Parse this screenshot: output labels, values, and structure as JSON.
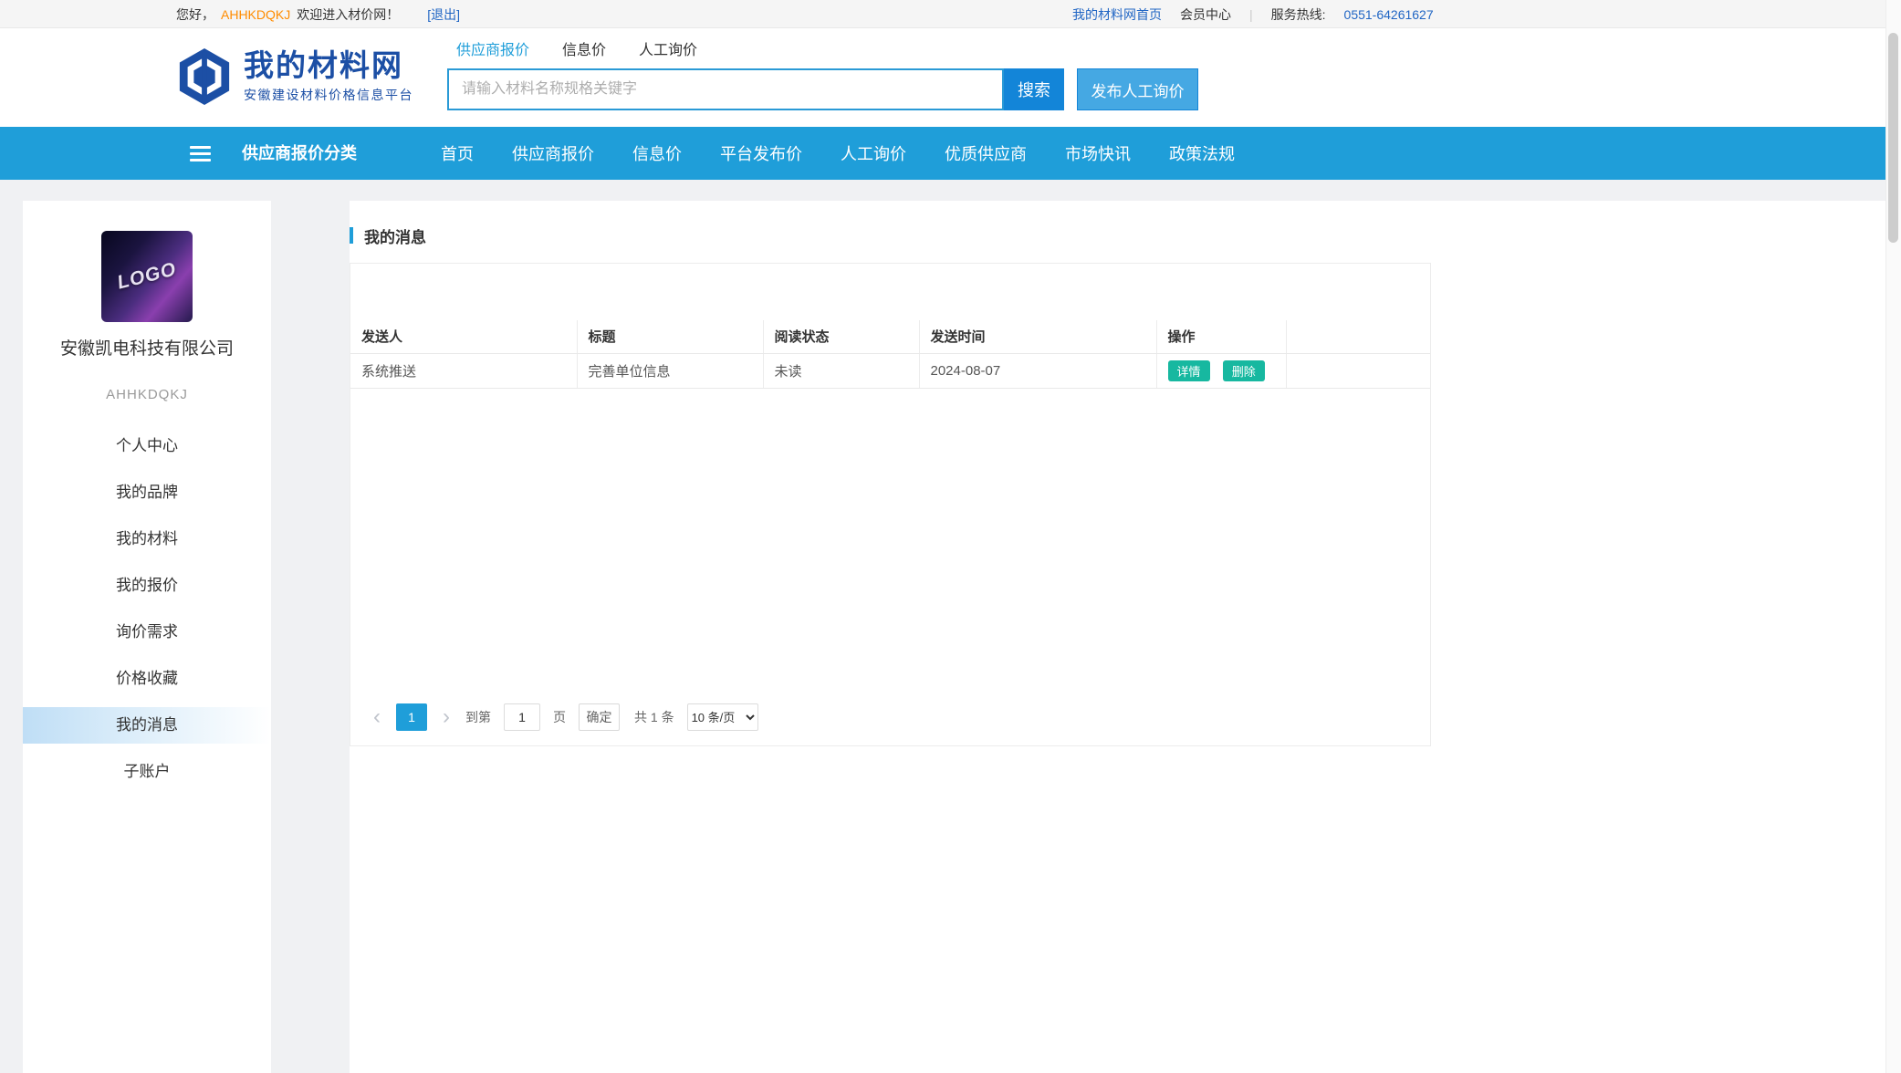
{
  "topbar": {
    "greeting_prefix": "您好，",
    "username": "AHHKDQKJ",
    "greeting_suffix": "欢迎进入材价网！",
    "logout_link": "[退出]",
    "home_link": "我的材料网首页",
    "member_center_link": "会员中心",
    "divider": "|",
    "hotline_label": "服务热线:",
    "hotline_number": "0551-64261627"
  },
  "header": {
    "site_name": "我的材料网",
    "site_subtitle": "安徽建设材料价格信息平台",
    "search_tabs": [
      {
        "label": "供应商报价",
        "active": true
      },
      {
        "label": "信息价",
        "active": false
      },
      {
        "label": "人工询价",
        "active": false
      }
    ],
    "search_placeholder": "请输入材料名称规格关键字",
    "search_button_label": "搜索",
    "publish_button_label": "发布人工询价"
  },
  "navbar": {
    "category_label": "供应商报价分类",
    "items": [
      "首页",
      "供应商报价",
      "信息价",
      "平台发布价",
      "人工询价",
      "优质供应商",
      "市场快讯",
      "政策法规"
    ]
  },
  "sidebar": {
    "logo_text": "LOGO",
    "company_name": "安徽凯电科技有限公司",
    "account_code": "AHHKDQKJ",
    "menu": [
      {
        "label": "个人中心",
        "active": false
      },
      {
        "label": "我的品牌",
        "active": false
      },
      {
        "label": "我的材料",
        "active": false
      },
      {
        "label": "我的报价",
        "active": false
      },
      {
        "label": "询价需求",
        "active": false
      },
      {
        "label": "价格收藏",
        "active": false
      },
      {
        "label": "我的消息",
        "active": true
      },
      {
        "label": "子账户",
        "active": false
      }
    ]
  },
  "main": {
    "section_title": "我的消息",
    "table": {
      "columns": [
        "发送人",
        "标题",
        "阅读状态",
        "发送时间",
        "操作"
      ],
      "rows": [
        {
          "sender": "系统推送",
          "title": "完善单位信息",
          "read_status": "未读",
          "sent_time": "2024-08-07",
          "actions": [
            "详情",
            "删除"
          ]
        }
      ]
    },
    "pagination": {
      "prev_icon": "‹",
      "current_page": "1",
      "next_icon": "›",
      "goto_prefix": "到第",
      "page_input_value": "1",
      "goto_suffix": "页",
      "confirm_label": "确定",
      "total_text": "共 1 条",
      "page_size_option": "10 条/页"
    }
  },
  "colors": {
    "primary_blue": "#1f9ed9",
    "deep_blue": "#1385d8",
    "logo_navy": "#1c4fa5",
    "link_blue": "#2166c4",
    "username_orange": "#ff8c00",
    "action_teal": "#17b8a0"
  }
}
